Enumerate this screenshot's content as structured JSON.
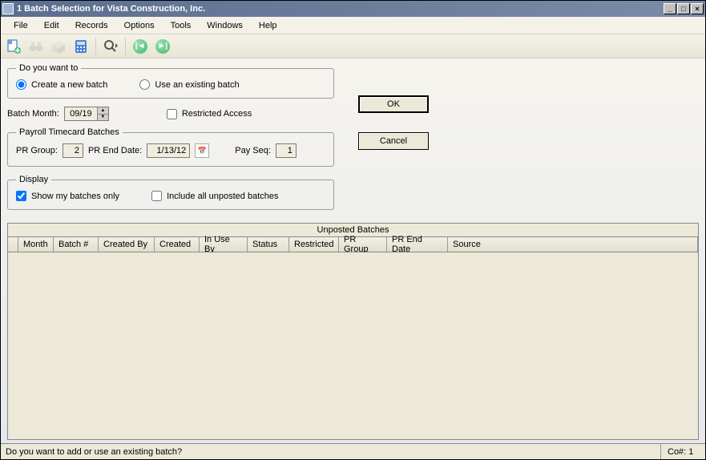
{
  "window": {
    "title": "1 Batch Selection for Vista Construction, Inc."
  },
  "menubar": {
    "items": [
      "File",
      "Edit",
      "Records",
      "Options",
      "Tools",
      "Windows",
      "Help"
    ]
  },
  "groups": {
    "do_you_want_to": {
      "legend": "Do you want to",
      "create_label": "Create a new batch",
      "use_label": "Use an existing batch"
    },
    "batch_month_label": "Batch Month:",
    "batch_month_value": "09/19",
    "restricted_access_label": "Restricted Access",
    "payroll": {
      "legend": "Payroll Timecard Batches",
      "pr_group_label": "PR Group:",
      "pr_group_value": "2",
      "pr_end_date_label": "PR End Date:",
      "pr_end_date_value": "1/13/12",
      "pay_seq_label": "Pay Seq:",
      "pay_seq_value": "1"
    },
    "display": {
      "legend": "Display",
      "show_my_label": "Show my batches only",
      "include_all_label": "Include all unposted batches"
    }
  },
  "buttons": {
    "ok": "OK",
    "cancel": "Cancel"
  },
  "grid": {
    "title": "Unposted Batches",
    "columns": [
      "Month",
      "Batch #",
      "Created By",
      "Created",
      "In Use By",
      "Status",
      "Restricted",
      "PR Group",
      "PR End Date",
      "Source"
    ]
  },
  "statusbar": {
    "left": "Do you want to add or use an existing batch?",
    "right": "Co#: 1"
  }
}
